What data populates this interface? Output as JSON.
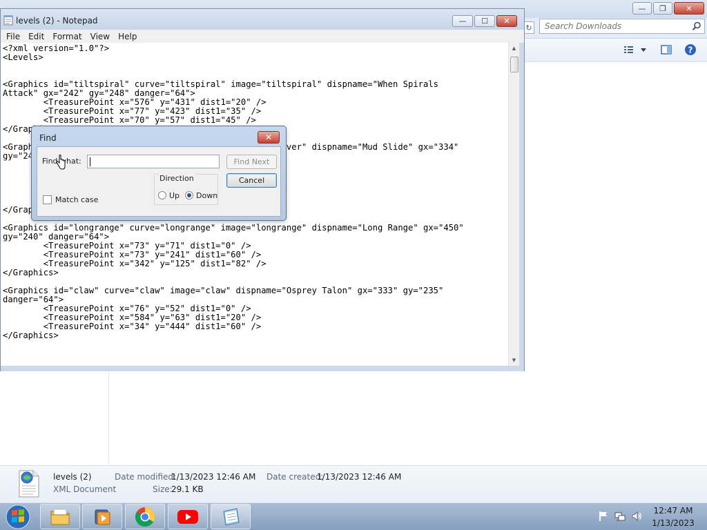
{
  "explorer": {
    "search_placeholder": "Search Downloads",
    "details": {
      "file_name": "levels (2)",
      "file_type": "XML Document",
      "date_modified_label": "Date modified:",
      "date_modified": "1/13/2023 12:46 AM",
      "date_created_label": "Date created:",
      "date_created": "1/13/2023 12:46 AM",
      "size_label": "Size:",
      "size": "29.1 KB"
    }
  },
  "notepad": {
    "title": "levels (2) - Notepad",
    "menu": [
      "File",
      "Edit",
      "Format",
      "View",
      "Help"
    ],
    "content": "<?xml version=\"1.0\"?>\n<Levels>\n\n\n<Graphics id=\"tiltspiral\" curve=\"tiltspiral\" image=\"tiltspiral\" dispname=\"When Spirals\nAttack\" gx=\"242\" gy=\"248\" danger=\"64\">\n        <TreasurePoint x=\"576\" y=\"431\" dist1=\"20\" />\n        <TreasurePoint x=\"77\" y=\"423\" dist1=\"35\" />\n        <TreasurePoint x=\"70\" y=\"57\" dist1=\"45\" />\n</Graphics>\n\n<Graphics id=\"underover\" curve=\"underover\" image=\"underover\" dispname=\"Mud Slide\" gx=\"334\"\ngy=\"245\" danger=\"64\">\n        <TreasurePoint x=\"76\" y=\"52\" dist1=\"0\" />\n        <TreasurePoint x=\"77\" y=\"423\" dist1=\"20\" />\n\n        <TreasurePoint x=\"70\" y=\"57\" dist1=\"45\" />\n        <TreasurePoint x=\"70\" y=\"57\" dist1=\"45\" />\n</Graphics>\n\n<Graphics id=\"longrange\" curve=\"longrange\" image=\"longrange\" dispname=\"Long Range\" gx=\"450\"\ngy=\"240\" danger=\"64\">\n        <TreasurePoint x=\"73\" y=\"71\" dist1=\"0\" />\n        <TreasurePoint x=\"73\" y=\"241\" dist1=\"60\" />\n        <TreasurePoint x=\"342\" y=\"125\" dist1=\"82\" />\n</Graphics>\n\n<Graphics id=\"claw\" curve=\"claw\" image=\"claw\" dispname=\"Osprey Talon\" gx=\"333\" gy=\"235\"\ndanger=\"64\">\n        <TreasurePoint x=\"76\" y=\"52\" dist1=\"0\" />\n        <TreasurePoint x=\"584\" y=\"63\" dist1=\"20\" />\n        <TreasurePoint x=\"34\" y=\"444\" dist1=\"60\" />\n</Graphics>"
  },
  "find_dialog": {
    "title": "Find",
    "find_what_label": "Find what:",
    "find_what_value": "",
    "find_next_label": "Find Next",
    "cancel_label": "Cancel",
    "direction_label": "Direction",
    "up_label": "Up",
    "down_label": "Down",
    "selected_direction": "down",
    "match_case_label": "Match case",
    "match_case_checked": false
  },
  "taskbar": {
    "time": "12:47 AM",
    "date": "1/13/2023"
  },
  "icons": {
    "search": "search-icon",
    "help": "help-icon",
    "start": "windows-start-icon"
  },
  "colors": {
    "close_red": "#c8453a",
    "taskbar_blue": "#87a0bf",
    "dialog_frame": "#b5c9e4"
  }
}
